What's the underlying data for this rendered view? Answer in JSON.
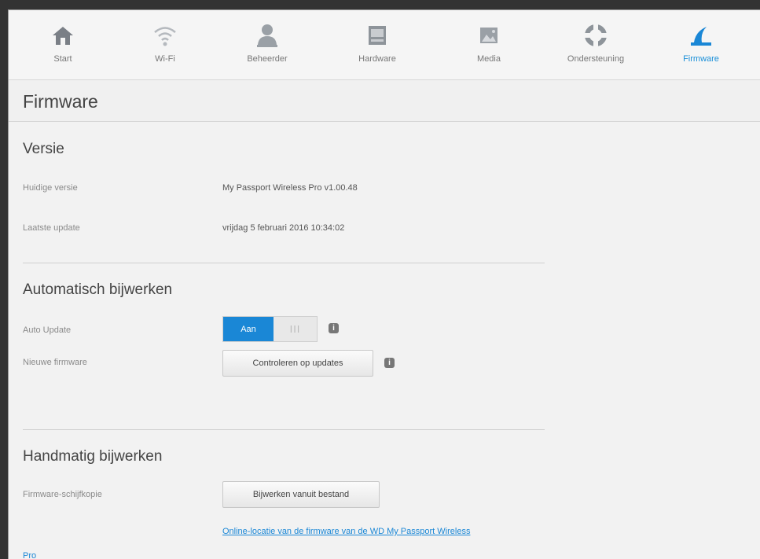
{
  "nav": {
    "items": [
      {
        "label": "Start",
        "icon": "home-icon"
      },
      {
        "label": "Wi-Fi",
        "icon": "wifi-icon"
      },
      {
        "label": "Beheerder",
        "icon": "user-icon"
      },
      {
        "label": "Hardware",
        "icon": "hardware-icon"
      },
      {
        "label": "Media",
        "icon": "media-icon"
      },
      {
        "label": "Ondersteuning",
        "icon": "support-icon"
      },
      {
        "label": "Firmware",
        "icon": "firmware-icon"
      }
    ],
    "active_index": 6
  },
  "page_title": "Firmware",
  "version_section": {
    "title": "Versie",
    "current_label": "Huidige versie",
    "current_value": "My Passport Wireless Pro v1.00.48",
    "last_update_label": "Laatste update",
    "last_update_value": "vrijdag 5 februari 2016 10:34:02"
  },
  "auto_section": {
    "title": "Automatisch bijwerken",
    "auto_update_label": "Auto Update",
    "toggle_on_label": "Aan",
    "toggle_off_glyph": "III",
    "new_firmware_label": "Nieuwe firmware",
    "check_button": "Controleren op updates",
    "info_glyph": "i"
  },
  "manual_section": {
    "title": "Handmatig bijwerken",
    "image_label": "Firmware-schijfkopie",
    "update_button": "Bijwerken vanuit bestand",
    "online_link_line1": "Online-locatie van de firmware van de WD My Passport Wireless",
    "online_link_line2": "Pro"
  },
  "colors": {
    "accent": "#1a87d6",
    "background": "#f2f2f2"
  }
}
